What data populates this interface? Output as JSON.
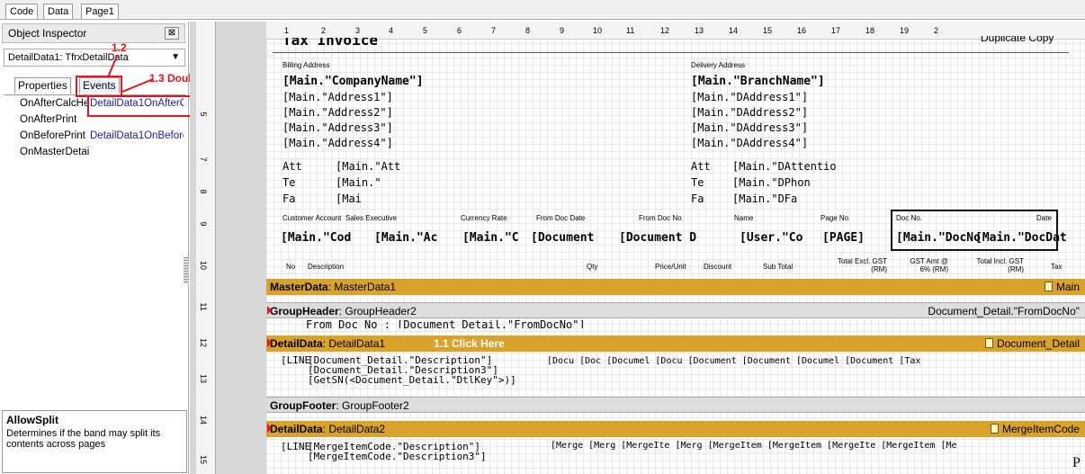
{
  "tabs": [
    "Code",
    "Data",
    "Page1"
  ],
  "inspector": {
    "title": "Object Inspector",
    "close_glyph": "⊠",
    "object_select": "DetailData1: TfrxDetailData",
    "tabs": [
      "Properties",
      "Events"
    ],
    "rows": [
      {
        "name": "OnAfterCalcHeight",
        "value": "DetailData1OnAfterCalcHeight"
      },
      {
        "name": "OnAfterPrint",
        "value": ""
      },
      {
        "name": "OnBeforePrint",
        "value": "DetailData1OnBeforePrint"
      },
      {
        "name": "OnMasterDetail",
        "value": ""
      }
    ],
    "help_title": "AllowSplit",
    "help_text": "Determines if the band may split its contents across pages"
  },
  "annotations": {
    "a12": "1.2",
    "a13": "1.3 Double click",
    "a11": "1.1 Click Here"
  },
  "ruler": {
    "h": [
      "1",
      "2",
      "3",
      "4",
      "5",
      "6",
      "7",
      "8",
      "9",
      "10",
      "11",
      "12",
      "13",
      "14",
      "15",
      "16",
      "17",
      "18",
      "19",
      "2"
    ],
    "v": [
      "5",
      "6",
      "7",
      "8",
      "9",
      "10",
      "11",
      "12",
      "13",
      "14",
      "15"
    ]
  },
  "report": {
    "title_partial": "Tax Invoice",
    "dup_partial": "Duplicate Copy",
    "billing_label": "Billing Address",
    "delivery_label": "Delivery Address",
    "company": "[Main.\"CompanyName\"]",
    "branch": "[Main.\"BranchName\"]",
    "addr": [
      "[Main.\"Address1\"]",
      "[Main.\"Address2\"]",
      "[Main.\"Address3\"]",
      "[Main.\"Address4\"]"
    ],
    "daddr": [
      "[Main.\"DAddress1\"]",
      "[Main.\"DAddress2\"]",
      "[Main.\"DAddress3\"]",
      "[Main.\"DAddress4\"]"
    ],
    "att": "Att",
    "te": "Te",
    "fa": "Fa",
    "main_att": "[Main.\"Att",
    "main_te": "[Main.\"",
    "main_fa": "[Mai",
    "main_datt": "[Main.\"DAttentio",
    "main_dphon": "[Main.\"DPhon",
    "main_dfa": "[Main.\"DFa",
    "hdr_labels": [
      "Customer Account",
      "Sales Executive",
      "Currency Rate",
      "From Doc Date",
      "From Doc No",
      "Name",
      "Page No",
      "Doc No.",
      "Date"
    ],
    "hdr_values": [
      "[Main.\"Cod",
      "[Main.\"Ac",
      "[Main.\"C",
      "[Document",
      "[Document D",
      "[User.\"Co",
      "[PAGE]",
      "[Main.\"DocNo",
      "[Main.\"DocDat"
    ],
    "col_labels": [
      "No",
      "Description",
      "Qty",
      "Price/Unit",
      "Discount",
      "Sub Total",
      "Total Excl. GST (RM)",
      "GST Amt @ 6% (RM)",
      "Total Incl. GST (RM)",
      "Tax"
    ],
    "master_band": "MasterData",
    "master_name": "MasterData1",
    "master_ds": "Main",
    "group_band": "GroupHeader",
    "group_name": "GroupHeader2",
    "group_expr": "Document_Detail.\"FromDocNo\"",
    "from_doc": "From Doc No : [Document_Detail.\"FromDocNo\"]",
    "detail_band": "DetailData",
    "detail_name": "DetailData1",
    "detail_ds": "Document_Detail",
    "line": "[LINE",
    "desc1": "[Document_Detail.\"Description\"]",
    "desc2": "[Document_Detail.\"Description3\"]",
    "desc3": "[GetSN(<Document_Detail.\"DtlKey\">)]",
    "detail_cols": "[Docu [Doc [Documel [Docu [Document [Document [Documel [Document [Tax",
    "gf_band": "GroupFooter",
    "gf_name": "GroupFooter2",
    "detail2_band": "DetailData",
    "detail2_name": "DetailData2",
    "detail2_ds": "MergeItemCode",
    "m_desc1": "[MergeItemCode.\"Description\"]",
    "m_desc2": "[MergeItemCode.\"Description3\"]",
    "m_cols": "[Merge [Merg [MergeIte [Merg [MergeItem [MergeItem [MergeIte [MergeItem [Me",
    "trail": "P"
  },
  "colors": {
    "band": "#d9a22a",
    "annotation": "#e8141c",
    "link": "#1a1aa6"
  }
}
